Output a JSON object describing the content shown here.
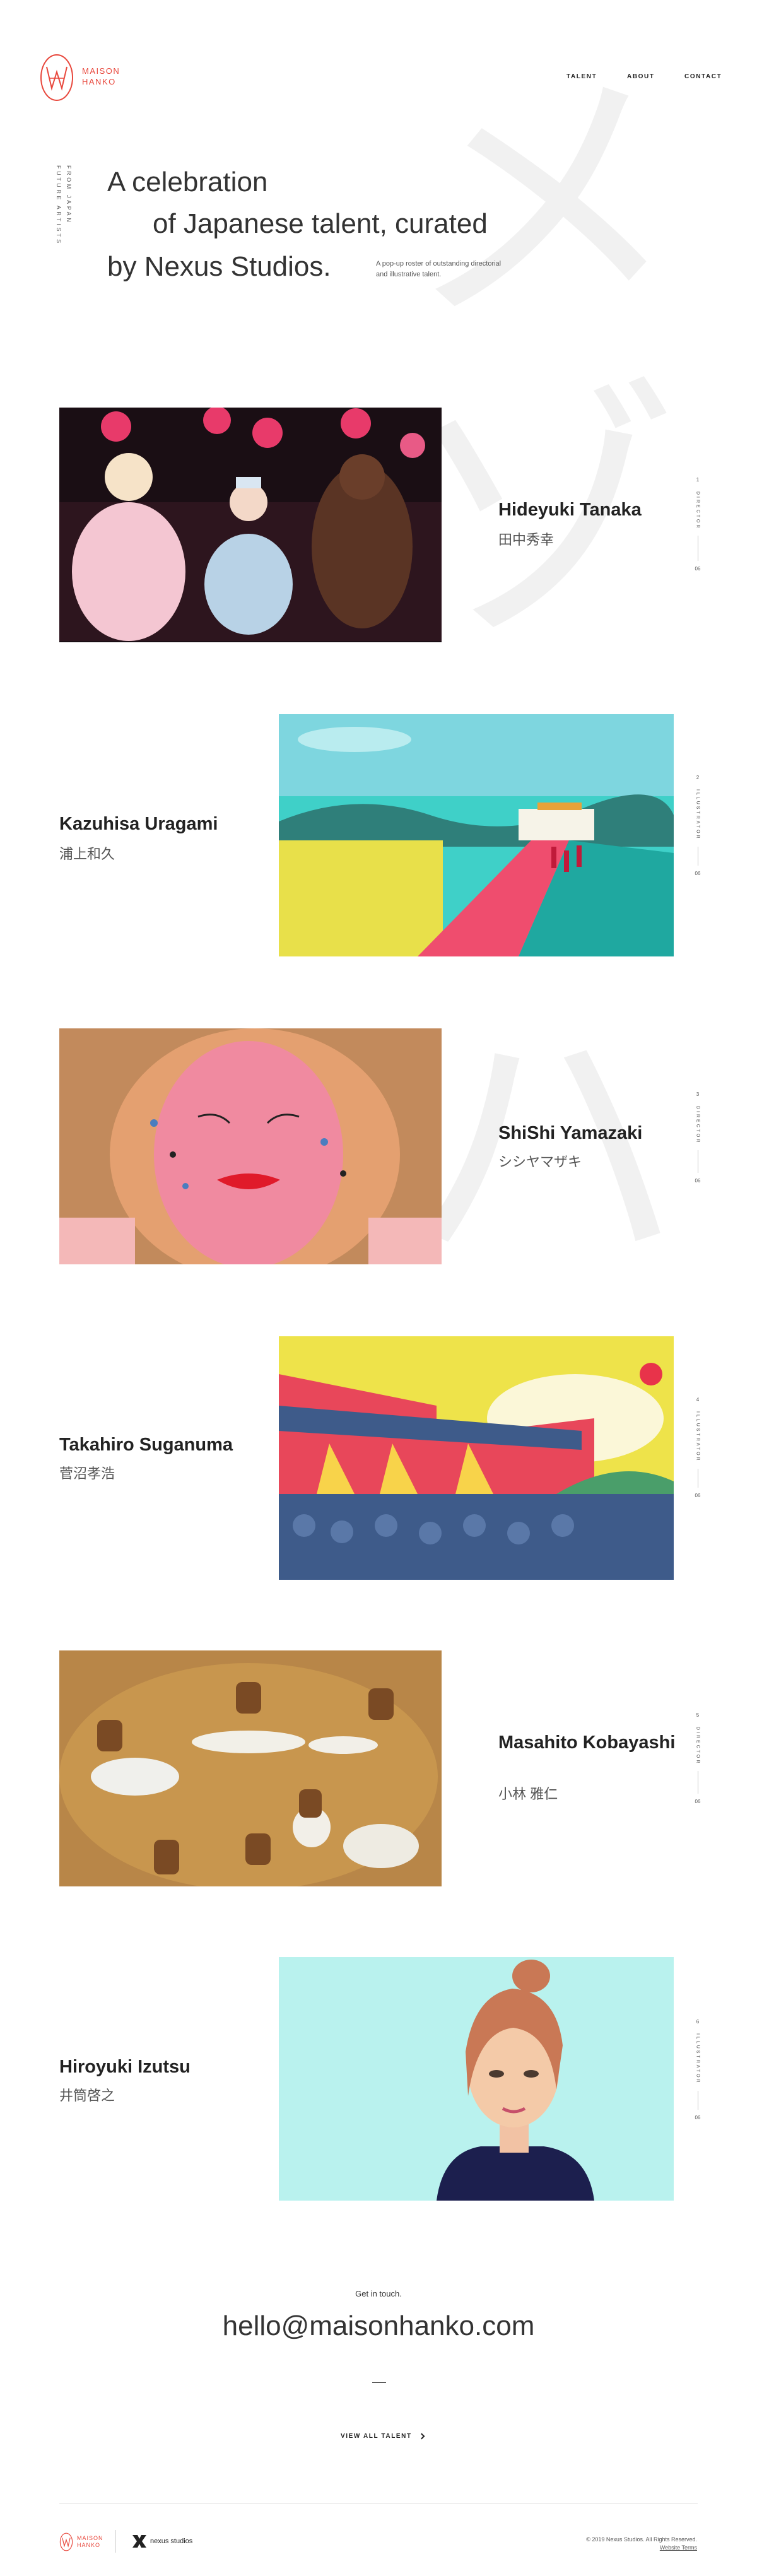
{
  "brand": {
    "logo_line1": "MAISON",
    "logo_line2": "HANKO",
    "accent": "#e8473c"
  },
  "nav": {
    "talent": "TALENT",
    "about": "ABOUT",
    "contact": "CONTACT"
  },
  "background_kana": [
    "メ",
    "ゾ",
    "ン",
    "ハ",
    "ン"
  ],
  "hero": {
    "vertical_left": "FUTURE ARTISTS",
    "vertical_right": "FROM JAPAN",
    "line1": "A celebration",
    "line2": "of Japanese talent, curated",
    "line3": "by Nexus Studios.",
    "subtext": "A pop-up roster of outstanding directorial and illustrative talent."
  },
  "talent": [
    {
      "name": "Hideyuki Tanaka",
      "jp": "田中秀幸",
      "index": "1",
      "category": "DIRECTOR",
      "total": "06"
    },
    {
      "name": "Kazuhisa Uragami",
      "jp": "浦上和久",
      "index": "2",
      "category": "ILLUSTRATOR",
      "total": "06"
    },
    {
      "name": "ShiShi Yamazaki",
      "jp": "シシヤマザキ",
      "index": "3",
      "category": "DIRECTOR",
      "total": "06"
    },
    {
      "name": "Takahiro Suganuma",
      "jp": "菅沼孝浩",
      "index": "4",
      "category": "ILLUSTRATOR",
      "total": "06"
    },
    {
      "name": "Masahito Kobayashi",
      "jp": "小林 雅仁",
      "index": "5",
      "category": "DIRECTOR",
      "total": "06"
    },
    {
      "name": "Hiroyuki Izutsu",
      "jp": "井筒啓之",
      "index": "6",
      "category": "ILLUSTRATOR",
      "total": "06"
    }
  ],
  "contact": {
    "lead": "Get in touch.",
    "email": "hello@maisonhanko.com"
  },
  "view_all": "VIEW ALL TALENT",
  "view_all_icon": "chevron-right-icon",
  "footer": {
    "logo_line1": "MAISON",
    "logo_line2": "HANKO",
    "partner": "nexus studios",
    "copyright": "© 2019 Nexus Studios. All Rights Reserved.",
    "links": "Website Terms"
  }
}
